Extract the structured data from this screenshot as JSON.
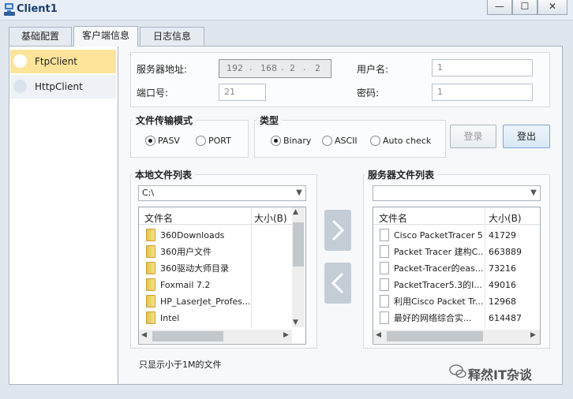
{
  "window": {
    "title": "Client1",
    "min_label": "—",
    "max_label": "☐",
    "close_label": "✕"
  },
  "tabs": [
    {
      "label": "基础配置"
    },
    {
      "label": "客户端信息"
    },
    {
      "label": "日志信息"
    }
  ],
  "sidebar": {
    "items": [
      {
        "label": "FtpClient"
      },
      {
        "label": "HttpClient"
      }
    ]
  },
  "server": {
    "addr_label": "服务器地址:",
    "addr_parts": [
      "192",
      "168",
      "2",
      "2"
    ],
    "port_label": "端口号:",
    "port_value": "21",
    "user_label": "用户名:",
    "user_value": "1",
    "pass_label": "密码:",
    "pass_value": "1"
  },
  "transfer_mode": {
    "title": "文件传输模式",
    "options": [
      "PASV",
      "PORT"
    ],
    "selected": "PASV"
  },
  "type": {
    "title": "类型",
    "options": [
      "Binary",
      "ASCII",
      "Auto check"
    ],
    "selected": "Binary"
  },
  "buttons": {
    "login": "登录",
    "logout": "登出"
  },
  "local": {
    "title": "本地文件列表",
    "path": "C:\\",
    "headers": [
      "文件名",
      "大小(B)"
    ],
    "rows": [
      {
        "name": "360Downloads"
      },
      {
        "name": "360用户文件"
      },
      {
        "name": "360驱动大师目录"
      },
      {
        "name": "Foxmail 7.2"
      },
      {
        "name": "HP_LaserJet_Profes..."
      },
      {
        "name": "Intel"
      }
    ]
  },
  "remote": {
    "title": "服务器文件列表",
    "path": "",
    "headers": [
      "文件名",
      "大小(B)"
    ],
    "rows": [
      {
        "name": "Cisco PacketTracer 5...",
        "size": "41729"
      },
      {
        "name": "Packet Tracer 建构C...",
        "size": "663889"
      },
      {
        "name": "Packet-Tracer的eas...",
        "size": "73216"
      },
      {
        "name": "PacketTracer5.3的I...",
        "size": "49016"
      },
      {
        "name": "利用Cisco Packet Tr...",
        "size": "12968"
      },
      {
        "name": "最好的网络综合实...",
        "size": "614487"
      }
    ]
  },
  "bottom_note": "只显示小于1M的文件",
  "watermark": "释然IT杂谈"
}
